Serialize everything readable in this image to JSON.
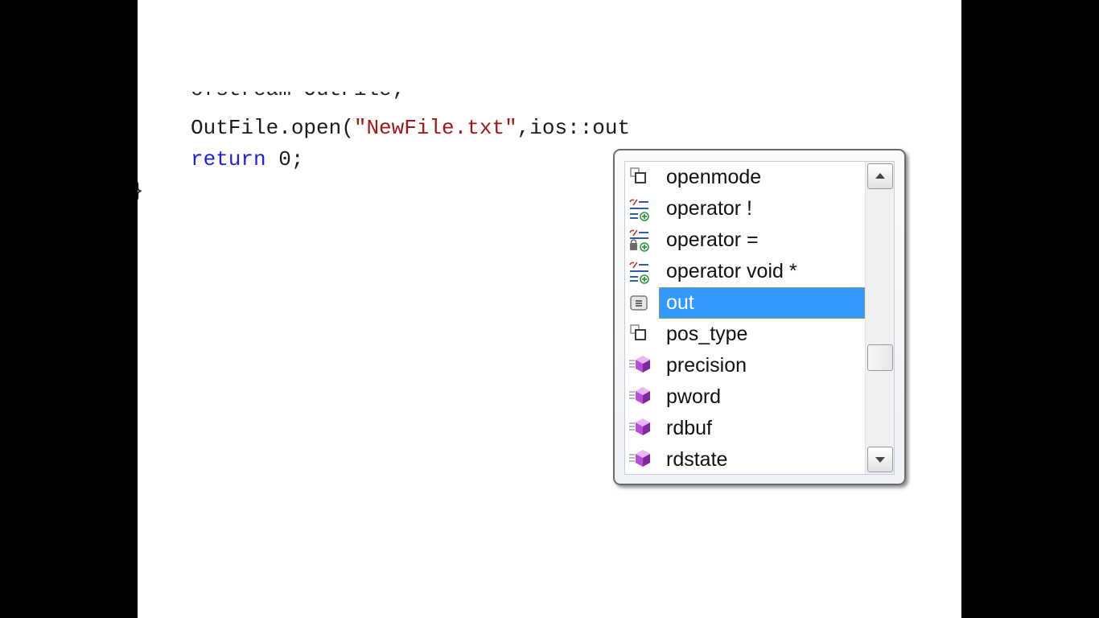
{
  "editor": {
    "cut_line": "ofstream OutFile;",
    "line1": {
      "object": "OutFile.open(",
      "string": "\"NewFile.txt\"",
      "rest": ",ios::out"
    },
    "line2": {
      "keyword": "return",
      "rest": " 0;"
    },
    "brace": "}"
  },
  "completion": {
    "items": [
      {
        "label": "openmode",
        "icon": "type-icon"
      },
      {
        "label": "operator !",
        "icon": "operator-icon"
      },
      {
        "label": "operator =",
        "icon": "protected-operator-icon"
      },
      {
        "label": "operator void *",
        "icon": "operator-icon"
      },
      {
        "label": "out",
        "icon": "enum-member-icon"
      },
      {
        "label": "pos_type",
        "icon": "type-icon"
      },
      {
        "label": "precision",
        "icon": "method-icon"
      },
      {
        "label": "pword",
        "icon": "method-icon"
      },
      {
        "label": "rdbuf",
        "icon": "method-icon"
      },
      {
        "label": "rdstate",
        "icon": "method-icon"
      }
    ],
    "selected_index": 4,
    "scroll_position": 0.68
  },
  "colors": {
    "selection": "#3399ff",
    "keyword": "#1f1fe0",
    "string": "#a31515",
    "method": "#b44fd6"
  }
}
